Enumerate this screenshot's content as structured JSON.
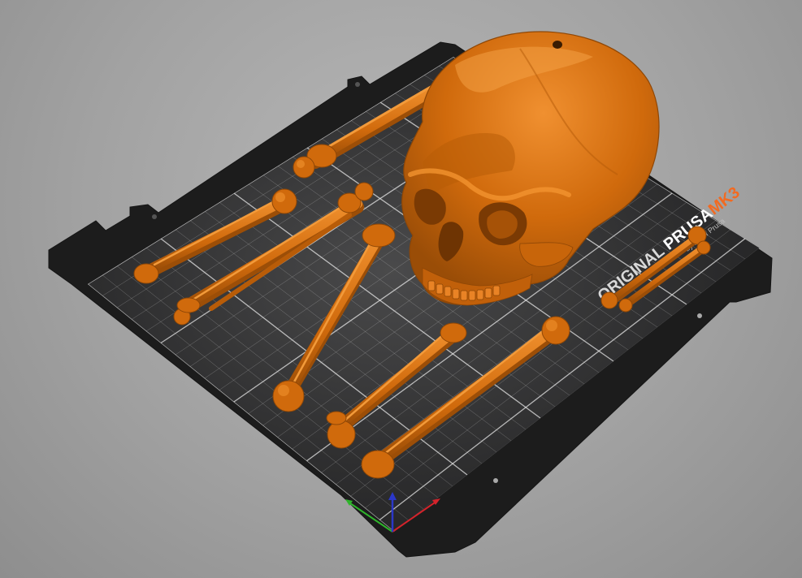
{
  "viewport": {
    "background_color": "#a3a3a3",
    "model_color": "#d06a0c",
    "model_shadow_color": "#8f4706",
    "model_highlight_color": "#f29430"
  },
  "bed": {
    "sheet_color": "#2b2b2c",
    "frame_color": "#1b1b1b",
    "grid_color": "#e6e6e6",
    "brand_text_part1": "ORIGINAL ",
    "brand_text_part2": "PRUSA",
    "brand_text_part3": "MK3",
    "brand_suffix": "by Josef Prusa",
    "brand_accent_color": "#f26a21"
  },
  "axes": {
    "x_axis": {
      "color": "#d4232b"
    },
    "y_axis": {
      "color": "#2fb52b"
    },
    "z_axis": {
      "color": "#2b37c8"
    }
  },
  "models": [
    {
      "name": "skull"
    },
    {
      "name": "bone-1"
    },
    {
      "name": "bone-2"
    },
    {
      "name": "bone-3"
    },
    {
      "name": "bone-4"
    },
    {
      "name": "bone-5"
    },
    {
      "name": "bone-6"
    },
    {
      "name": "bone-7"
    },
    {
      "name": "bone-8"
    }
  ]
}
